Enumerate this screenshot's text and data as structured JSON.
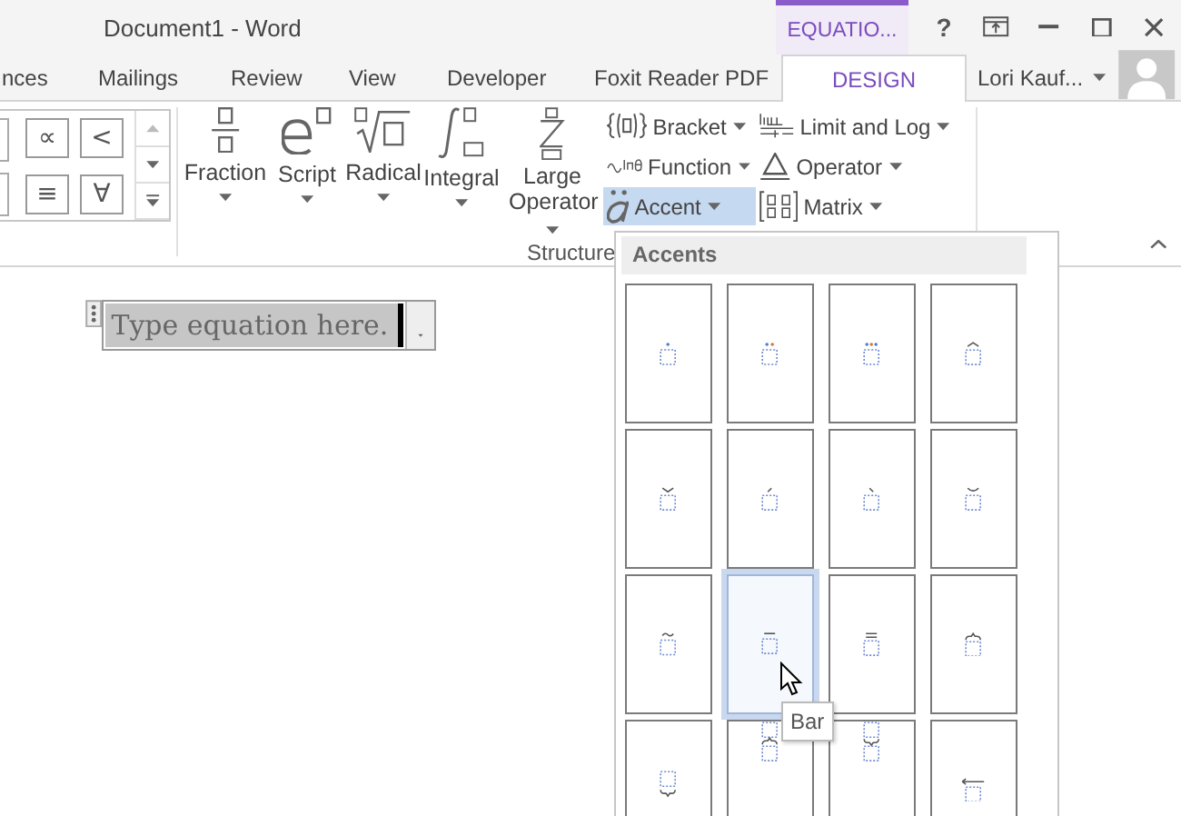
{
  "window": {
    "title": "Document1 - Word",
    "context_tab": "EQUATIO...",
    "help": "?",
    "user": "Lori Kauf..."
  },
  "tabs": [
    {
      "label": "nces",
      "selected": false
    },
    {
      "label": "Mailings",
      "selected": false
    },
    {
      "label": "Review",
      "selected": false
    },
    {
      "label": "View",
      "selected": false
    },
    {
      "label": "Developer",
      "selected": false
    },
    {
      "label": "Foxit Reader PDF",
      "selected": false
    },
    {
      "label": "DESIGN",
      "selected": true
    }
  ],
  "symbols": [
    {
      "cells": [
        "∝",
        "<"
      ]
    },
    {
      "cells": [
        "≡",
        "∀"
      ]
    }
  ],
  "structures": {
    "group_label": "Structure",
    "large": [
      {
        "label": "Fraction",
        "kind": "fraction"
      },
      {
        "label": "Script",
        "kind": "script"
      },
      {
        "label": "Radical",
        "kind": "radical"
      },
      {
        "label": "Integral",
        "kind": "integral"
      },
      {
        "label": "Large Operator",
        "kind": "sum"
      }
    ],
    "small": [
      {
        "label": "Bracket",
        "kind": "bracket",
        "selected": false
      },
      {
        "label": "Function",
        "kind": "function",
        "selected": false
      },
      {
        "label": "Accent",
        "kind": "accent",
        "selected": true
      },
      {
        "label": "Limit and Log",
        "kind": "limit",
        "selected": false
      },
      {
        "label": "Operator",
        "kind": "operator",
        "selected": false
      },
      {
        "label": "Matrix",
        "kind": "matrix",
        "selected": false
      }
    ]
  },
  "equation": {
    "placeholder": "Type equation here."
  },
  "accent_menu": {
    "header": "Accents",
    "items": [
      {
        "kind": "dot",
        "selected": false
      },
      {
        "kind": "ddot",
        "selected": false
      },
      {
        "kind": "dddot",
        "selected": false
      },
      {
        "kind": "hat",
        "selected": false
      },
      {
        "kind": "check",
        "selected": false
      },
      {
        "kind": "acute",
        "selected": false
      },
      {
        "kind": "grave",
        "selected": false
      },
      {
        "kind": "breve",
        "selected": false
      },
      {
        "kind": "tilde",
        "selected": false
      },
      {
        "kind": "bar",
        "selected": true
      },
      {
        "kind": "double-bar",
        "selected": false
      },
      {
        "kind": "overbrace",
        "selected": false
      },
      {
        "kind": "underbrace",
        "selected": false
      },
      {
        "kind": "group-over",
        "selected": false
      },
      {
        "kind": "group-under",
        "selected": false
      },
      {
        "kind": "left-arrow",
        "selected": false
      }
    ]
  },
  "tooltip": "Bar"
}
